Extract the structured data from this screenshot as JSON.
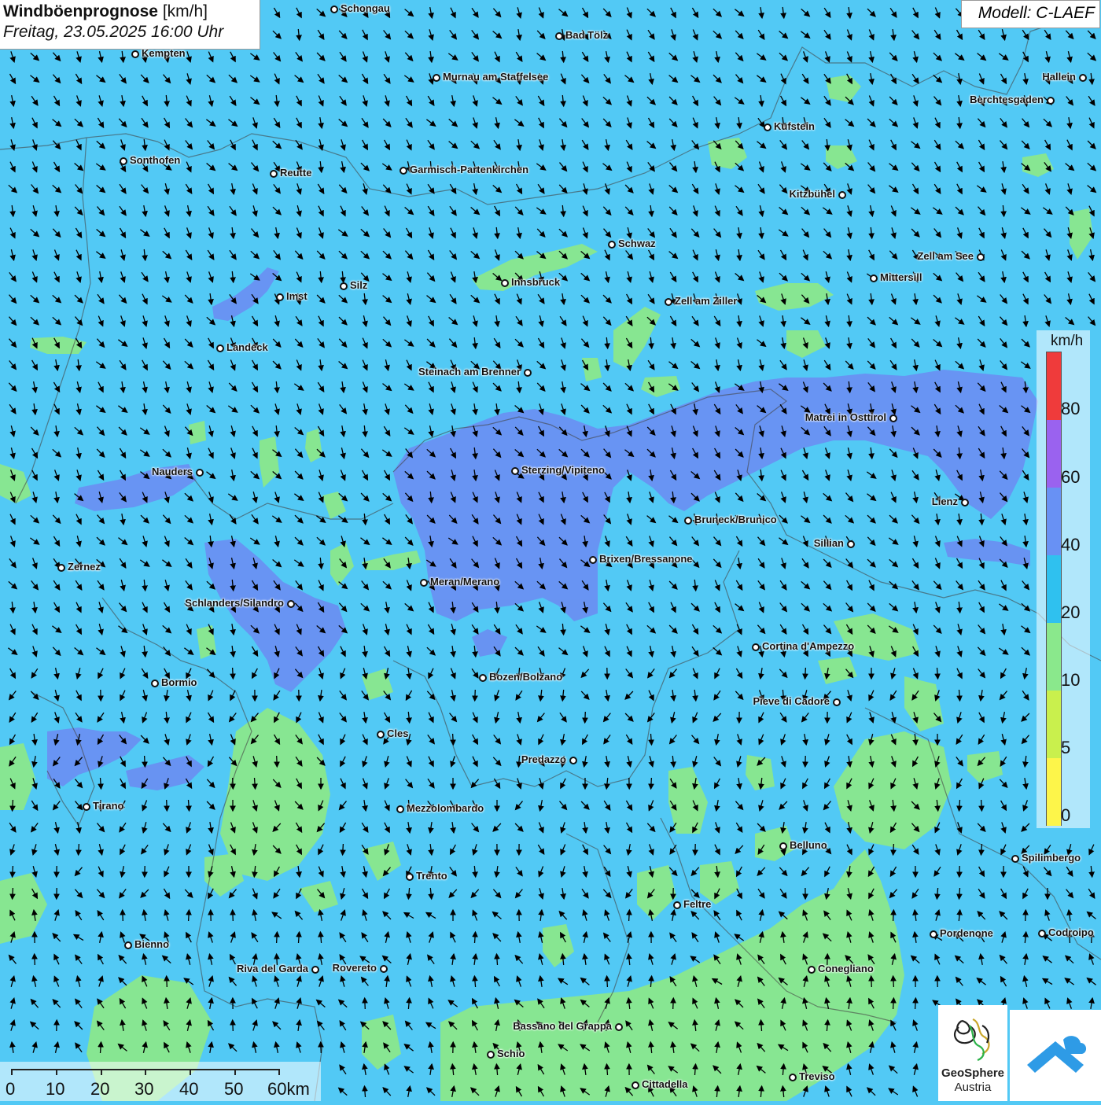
{
  "title": {
    "main": "Windböenprognose",
    "unit": "[km/h]",
    "datetime": "Freitag, 23.05.2025 16:00 Uhr"
  },
  "model": "Modell: C-LAEF",
  "legend": {
    "unit": "km/h",
    "labels": [
      "80",
      "60",
      "40",
      "20",
      "10",
      "5",
      "0"
    ],
    "colors": {
      "0-5": "#fdf54a",
      "5-10": "#c9f04d",
      "10-20": "#8ae88c",
      "20-40": "#2fc1ef",
      "40-60": "#6891f4",
      "60-80": "#9a62ef",
      "80+": "#ef3b3b"
    }
  },
  "scale_bar": {
    "labels": [
      "0",
      "10",
      "20",
      "30",
      "40",
      "50",
      "60km"
    ]
  },
  "logos": {
    "geosphere": [
      "GeoSphere",
      "Austria"
    ]
  },
  "cities": [
    "Schongau",
    "Bad Tölz",
    "Kempten",
    "Murnau am Staffelsee",
    "Hallein",
    "Berchtesgaden",
    "Kufstein",
    "Sonthofen",
    "Reutte",
    "Garmisch-Partenkirchen",
    "Kitzbühel",
    "Schwaz",
    "Zell am See",
    "Mittersill",
    "Innsbruck",
    "Silz",
    "Imst",
    "Zell am Ziller",
    "Landeck",
    "Steinach am Brenner",
    "Matrei in Osttirol",
    "Nauders",
    "Sterzing/Vipiteno",
    "Lienz",
    "Bruneck/Brunico",
    "Sillian",
    "Zernez",
    "Brixen/Bressanone",
    "Meran/Merano",
    "Schlanders/Silandro",
    "Cortina d'Ampezzo",
    "Bormio",
    "Bozen/Bolzano",
    "Pieve di Cadore",
    "Cles",
    "Predazzo",
    "Tirano",
    "Mezzolombardo",
    "Belluno",
    "Spilimbergo",
    "Trento",
    "Feltre",
    "Bienno",
    "Pordenone",
    "Codroipo",
    "Riva del Garda",
    "Rovereto",
    "Conegliano",
    "Bassano del Grappa",
    "Schio",
    "Treviso",
    "Cittadella"
  ]
}
